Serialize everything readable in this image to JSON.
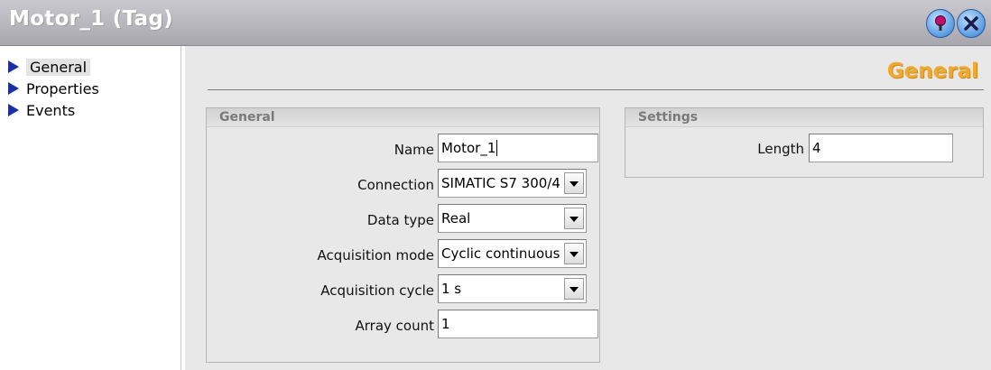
{
  "window": {
    "title": "Motor_1 (Tag)"
  },
  "nav": {
    "items": [
      {
        "label": "General",
        "selected": true
      },
      {
        "label": "Properties",
        "selected": false
      },
      {
        "label": "Events",
        "selected": false
      }
    ]
  },
  "main": {
    "title": "General"
  },
  "general_group": {
    "title": "General",
    "name_label": "Name",
    "name_value": "Motor_1",
    "connection_label": "Connection",
    "connection_value": "SIMATIC S7 300/4",
    "datatype_label": "Data type",
    "datatype_value": "Real",
    "acqmode_label": "Acquisition mode",
    "acqmode_value": "Cyclic continuous",
    "acqcycle_label": "Acquisition cycle",
    "acqcycle_value": "1 s",
    "arraycount_label": "Array count",
    "arraycount_value": "1"
  },
  "settings_group": {
    "title": "Settings",
    "length_label": "Length",
    "length_value": "4"
  },
  "colors": {
    "accent_orange": "#f0a92e",
    "nav_arrow_blue": "#1b2fa8"
  },
  "icons": {
    "help": "help-icon",
    "close": "close-icon",
    "nav_arrow": "triangle-right-icon"
  }
}
